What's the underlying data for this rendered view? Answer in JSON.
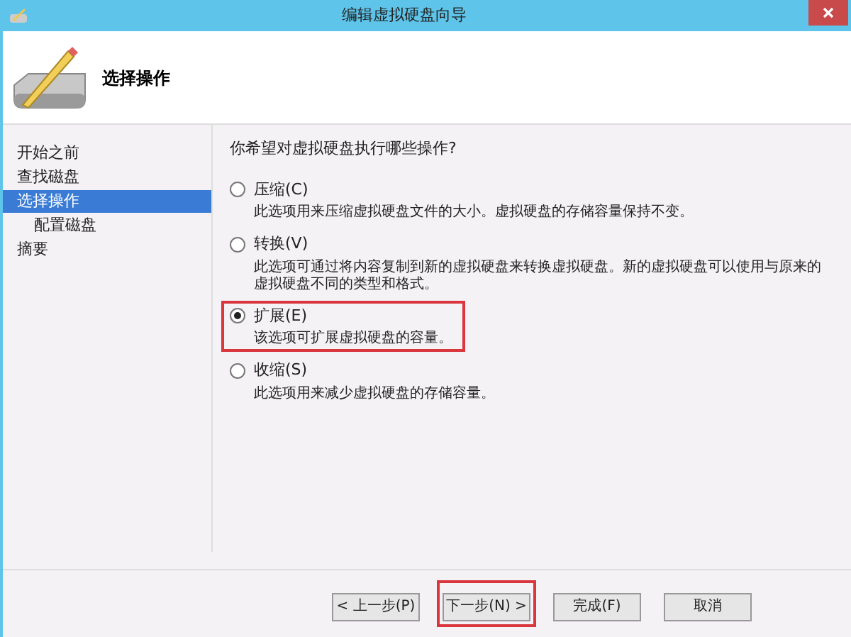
{
  "window": {
    "title": "编辑虚拟硬盘向导"
  },
  "header": {
    "title": "选择操作"
  },
  "sidebar": {
    "items": [
      {
        "label": "开始之前",
        "selected": false
      },
      {
        "label": "查找磁盘",
        "selected": false
      },
      {
        "label": "选择操作",
        "selected": true,
        "children": [
          {
            "label": "配置磁盘",
            "selected": false
          }
        ]
      },
      {
        "label": "摘要",
        "selected": false
      }
    ]
  },
  "question": "你希望对虚拟硬盘执行哪些操作?",
  "options": [
    {
      "label": "压缩(C)",
      "description": "此选项用来压缩虚拟硬盘文件的大小。虚拟硬盘的存储容量保持不变。",
      "selected": false,
      "highlighted": false
    },
    {
      "label": "转换(V)",
      "description": "此选项可通过将内容复制到新的虚拟硬盘来转换虚拟硬盘。新的虚拟硬盘可以使用与原来的虚拟硬盘不同的类型和格式。",
      "selected": false,
      "highlighted": false
    },
    {
      "label": "扩展(E)",
      "description": "该选项可扩展虚拟硬盘的容量。",
      "selected": true,
      "highlighted": true
    },
    {
      "label": "收缩(S)",
      "description": "此选项用来减少虚拟硬盘的存储容量。",
      "selected": false,
      "highlighted": false
    }
  ],
  "buttons": [
    {
      "label": "< 上一步(P)",
      "highlighted": false
    },
    {
      "label": "下一步(N) >",
      "highlighted": true
    },
    {
      "label": "完成(F)",
      "highlighted": false
    },
    {
      "label": "取消",
      "highlighted": false
    }
  ]
}
